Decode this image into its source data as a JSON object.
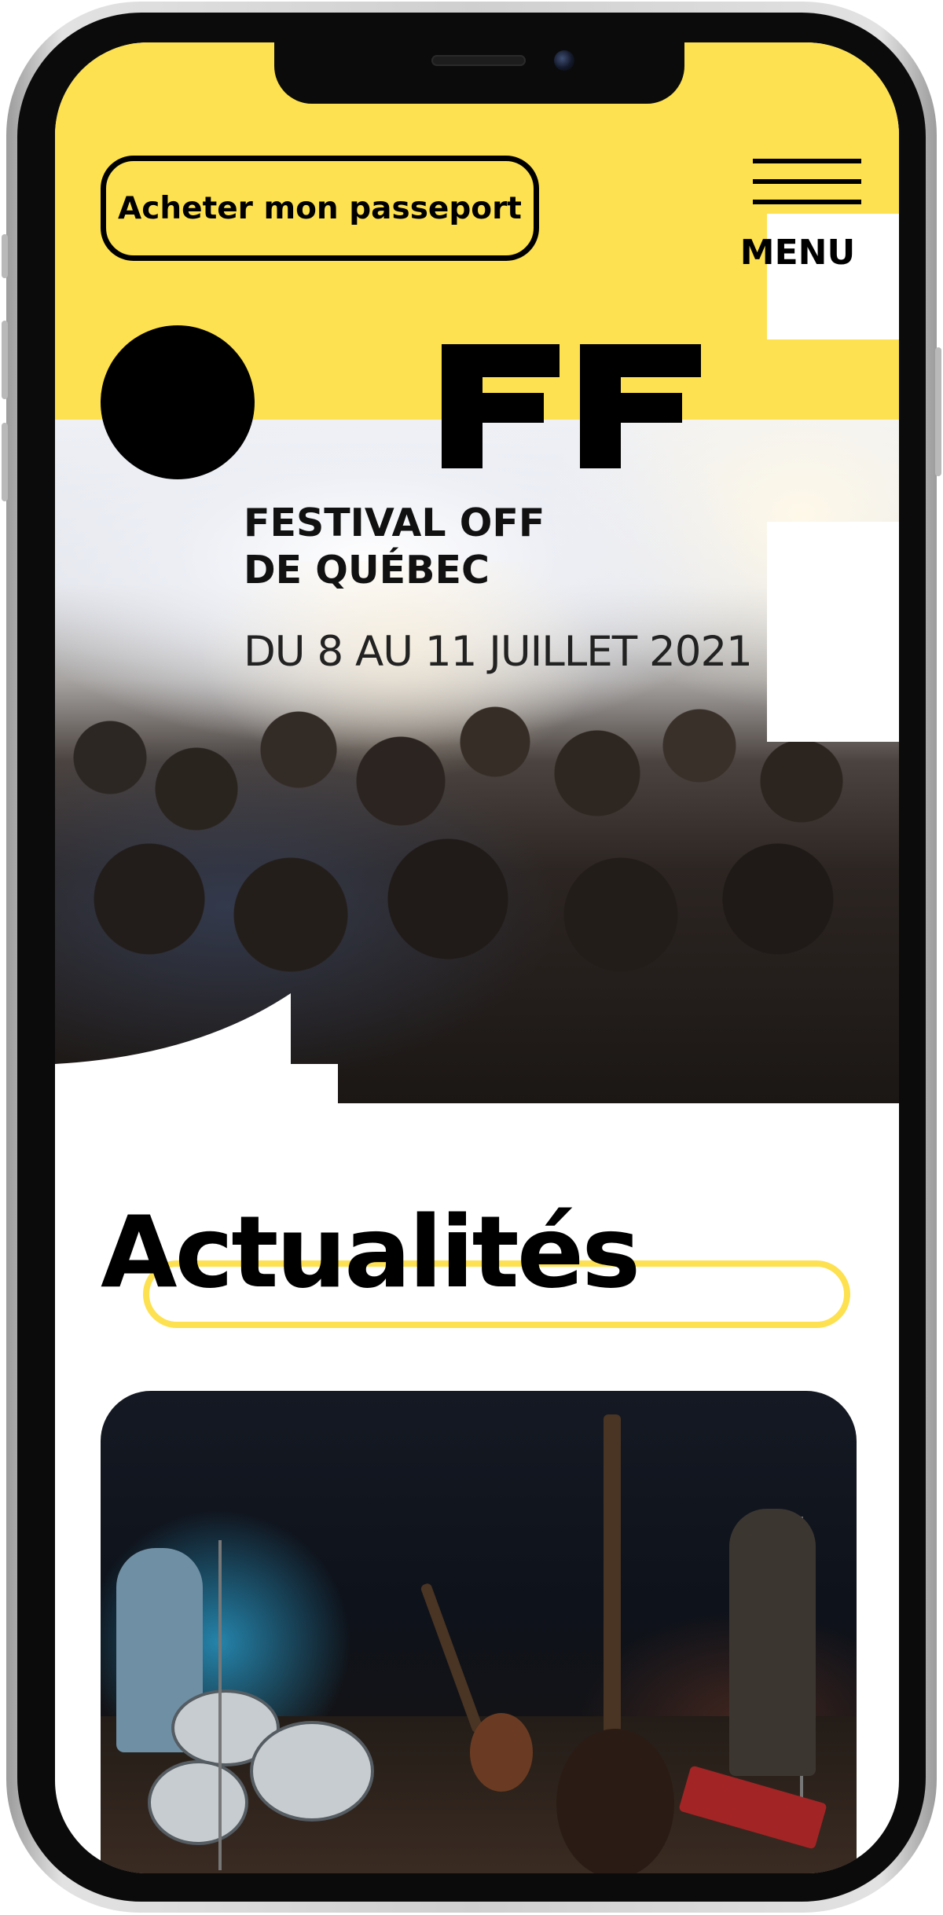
{
  "header": {
    "pass_button_label": "Acheter mon passeport",
    "menu_label": "MENU"
  },
  "brand": {
    "logo_text": "FF",
    "title_line1": "FESTIVAL OFF",
    "title_line2": "DE QUÉBEC",
    "dates": "DU 8 AU 11 JUILLET 2021"
  },
  "news": {
    "heading": "Actualités"
  },
  "colors": {
    "accent_yellow": "#fde150",
    "text_black": "#000000",
    "background_white": "#ffffff"
  },
  "icons": {
    "menu": "hamburger-menu-icon",
    "logo_circle": "black-circle-shape"
  }
}
